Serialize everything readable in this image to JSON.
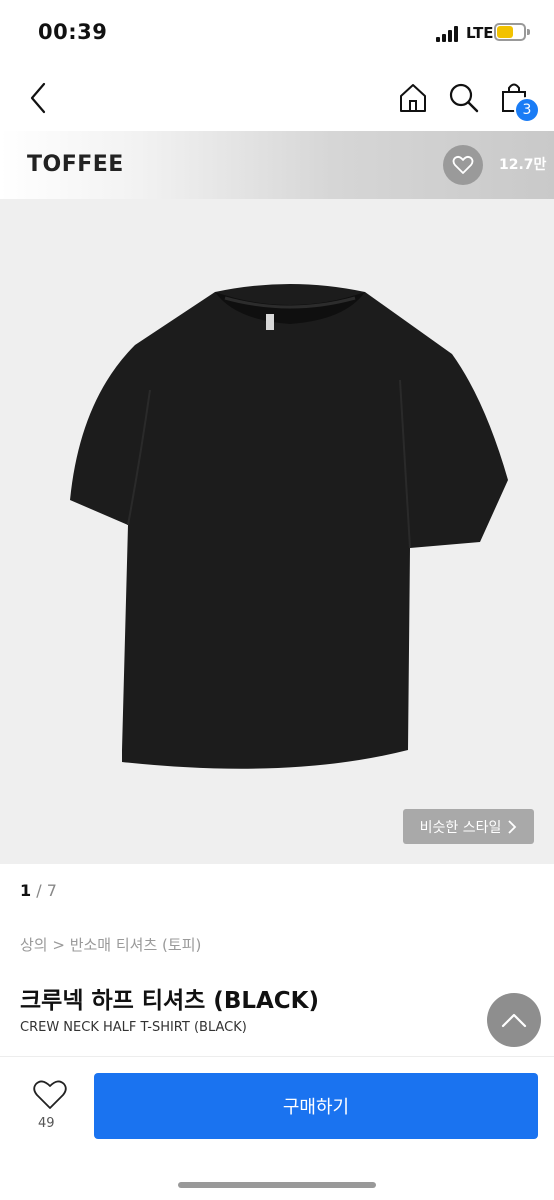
{
  "status_bar": {
    "time": "00:39",
    "network": "LTE",
    "battery_color": "#f2c200"
  },
  "nav": {
    "cart_count": "3"
  },
  "brand": {
    "name": "TOFFEE",
    "like_count": "12.7만"
  },
  "image": {
    "similar_label": "비슷한 스타일",
    "current_page": "1",
    "page_separator": " / ",
    "total_pages": "7"
  },
  "product": {
    "breadcrumb": "상의 > 반소매 티셔츠 (토피)",
    "title_ko": "크루넥 하프 티셔츠 (BLACK)",
    "title_en": "CREW NECK HALF T-SHIRT (BLACK)"
  },
  "bottom_bar": {
    "like_count": "49",
    "buy_label": "구매하기"
  },
  "colors": {
    "accent": "#1a73f0",
    "badge": "#1a7cf5"
  }
}
